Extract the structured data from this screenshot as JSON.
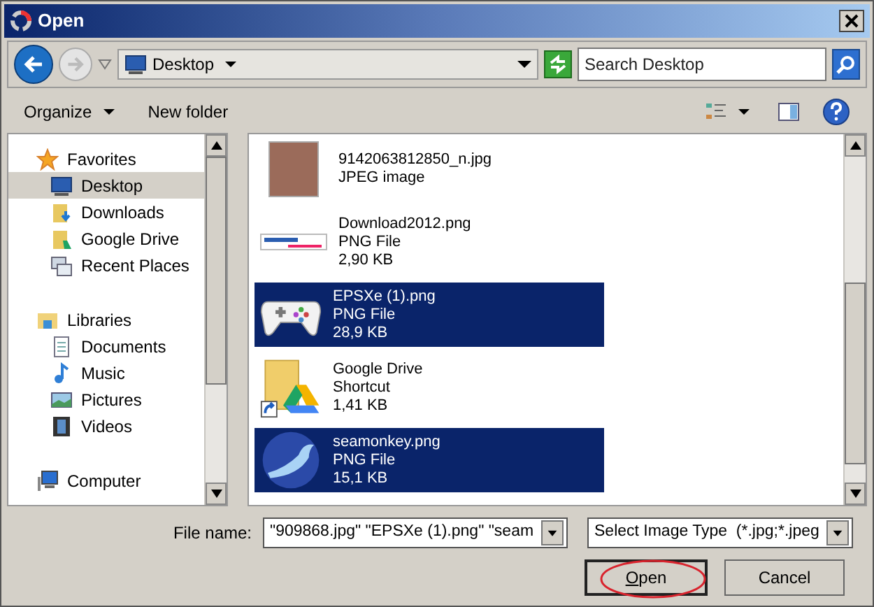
{
  "window": {
    "title": "Open"
  },
  "address": {
    "location": "Desktop",
    "search_placeholder": "Search Desktop"
  },
  "toolbar": {
    "organize": "Organize",
    "new_folder": "New folder"
  },
  "sidebar": {
    "groups": [
      {
        "label": "Favorites",
        "kind": "star",
        "children": [
          {
            "label": "Desktop",
            "kind": "desktop",
            "selected": true
          },
          {
            "label": "Downloads",
            "kind": "downloads",
            "selected": false
          },
          {
            "label": "Google Drive",
            "kind": "folder",
            "selected": false
          },
          {
            "label": "Recent Places",
            "kind": "recent",
            "selected": false
          }
        ]
      },
      {
        "label": "Libraries",
        "kind": "library",
        "children": [
          {
            "label": "Documents",
            "kind": "document",
            "selected": false
          },
          {
            "label": "Music",
            "kind": "music",
            "selected": false
          },
          {
            "label": "Pictures",
            "kind": "pictures",
            "selected": false
          },
          {
            "label": "Videos",
            "kind": "videos",
            "selected": false
          }
        ]
      },
      {
        "label": "Computer",
        "kind": "computer"
      }
    ]
  },
  "files": [
    {
      "kind": "photo",
      "name": "9142063812850_n.jpg",
      "type": "JPEG image",
      "selected": false
    },
    {
      "kind": "banner",
      "name": "Download2012.png",
      "type": "PNG File",
      "size": "2,90 KB",
      "selected": false
    },
    {
      "kind": "gamepad",
      "name": "EPSXe (1).png",
      "type": "PNG File",
      "size": "28,9 KB",
      "selected": true
    },
    {
      "kind": "shortcut",
      "name": "Google Drive",
      "type": "Shortcut",
      "size": "1,41 KB",
      "selected": false
    },
    {
      "kind": "bird",
      "name": "seamonkey.png",
      "type": "PNG File",
      "size": "15,1 KB",
      "selected": true
    }
  ],
  "footer": {
    "file_name_label": "File name:",
    "file_name_value": "\"909868.jpg\" \"EPSXe (1).png\" \"seam",
    "file_type": "Select Image Type  (*.jpg;*.jpeg",
    "open": "Open",
    "cancel": "Cancel",
    "open_highlighted": true
  }
}
